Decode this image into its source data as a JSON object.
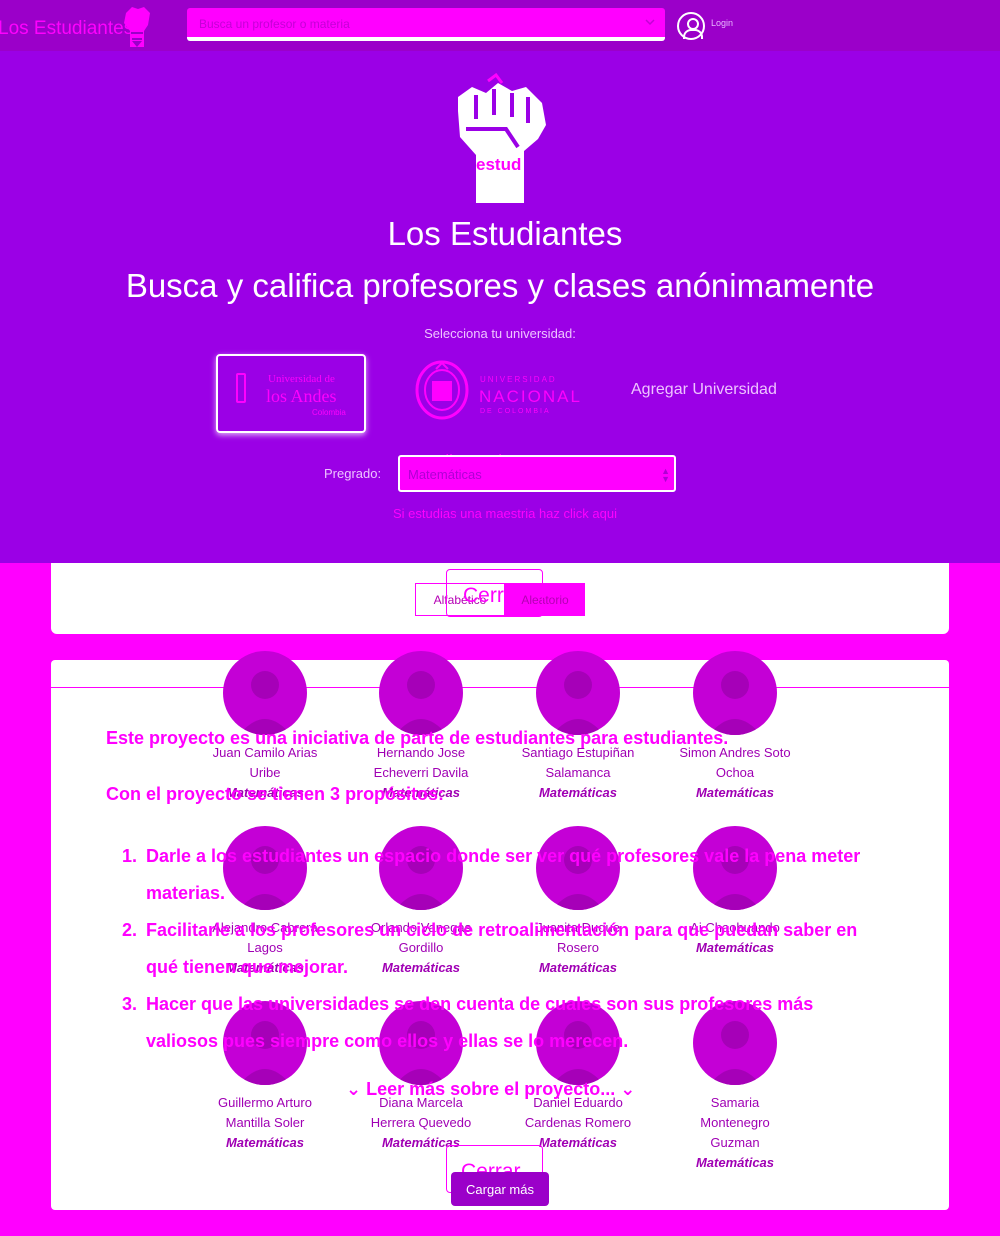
{
  "navbar": {
    "brand": "Los Estudiantes",
    "search_placeholder": "Busca un profesor o materia",
    "user_label": "Login"
  },
  "hero": {
    "logo_word": "estud",
    "title": "Los Estudiantes",
    "subtitle": "Busca y califica profesores y clases anónimamente",
    "select_university_label": "Selecciona tu universidad:",
    "universities": [
      {
        "line1": "Universidad de",
        "line2": "los Andes",
        "line3": "Colombia"
      },
      {
        "line1": "UNIVERSIDAD",
        "line2": "NACIONAL",
        "line3": "DE COLOMBIA"
      }
    ],
    "add_university": "Agregar Universidad",
    "overlap_text": "os y ellas se lo merecen.",
    "pregrado_label": "Pregrado:",
    "pregrado_value": "Matemáticas",
    "maestria_hint": "Si estudias una maestria haz click aqui"
  },
  "sort": {
    "alphabetical": "Alfabético",
    "random": "Aleatorio",
    "close": "Cerrar"
  },
  "professors": [
    {
      "name_lines": [
        "Juan Camilo Arias",
        "Uribe"
      ],
      "subject": "Matemáticas"
    },
    {
      "name_lines": [
        "Hernando Jose",
        "Echeverri Davila"
      ],
      "subject": "Matemáticas"
    },
    {
      "name_lines": [
        "Santiago Estupiñan",
        "Salamanca"
      ],
      "subject": "Matemáticas"
    },
    {
      "name_lines": [
        "Simon Andres Soto",
        "Ochoa"
      ],
      "subject": "Matemáticas"
    },
    {
      "name_lines": [
        "Alejandro Cabrera",
        "Lagos"
      ],
      "subject": "Matemáticas"
    },
    {
      "name_lines": [
        "Orlando Vanegas",
        "Gordillo"
      ],
      "subject": "Matemáticas"
    },
    {
      "name_lines": [
        "Juanita Duque",
        "Rosero"
      ],
      "subject": "Matemáticas"
    },
    {
      "name_lines": [
        "Ai Chaohuando"
      ],
      "subject": "Matemáticas"
    },
    {
      "name_lines": [
        "Guillermo Arturo",
        "Mantilla Soler"
      ],
      "subject": "Matemáticas"
    },
    {
      "name_lines": [
        "Diana Marcela",
        "Herrera Quevedo"
      ],
      "subject": "Matemáticas"
    },
    {
      "name_lines": [
        "Daniel Eduardo",
        "Cardenas Romero"
      ],
      "subject": "Matemáticas"
    },
    {
      "name_lines": [
        "Samaria",
        "Montenegro",
        "Guzman"
      ],
      "subject": "Matemáticas"
    }
  ],
  "about": {
    "intro": "Este proyecto es una iniciativa de parte de estudiantes para estudiantes.",
    "purpose": "Con el proyecto se tienen 3 propósitos:",
    "items": [
      {
        "num": "1.",
        "text": "Darle a los estudiantes un espacio donde ser ver qué profesores vale la pena meter materias."
      },
      {
        "num": "2.",
        "text": "Facilitarle a los profesores un ciclo de retroalimentación para que puedan saber en qué tienen que mejorar."
      },
      {
        "num": "3.",
        "text": "Hacer que las universidades se den cuenta de cuales son sus profesores más valiosos pues siempre como ellos y ellas se lo merecen."
      }
    ],
    "read_more": "Leer más sobre el proyecto...",
    "close": "Cerrar"
  },
  "load_more": "Cargar más",
  "colors": {
    "navbar": "#9b00c9",
    "hero": "#9b00e6",
    "accent": "#ff00ff",
    "avatar": "#c400d6"
  }
}
